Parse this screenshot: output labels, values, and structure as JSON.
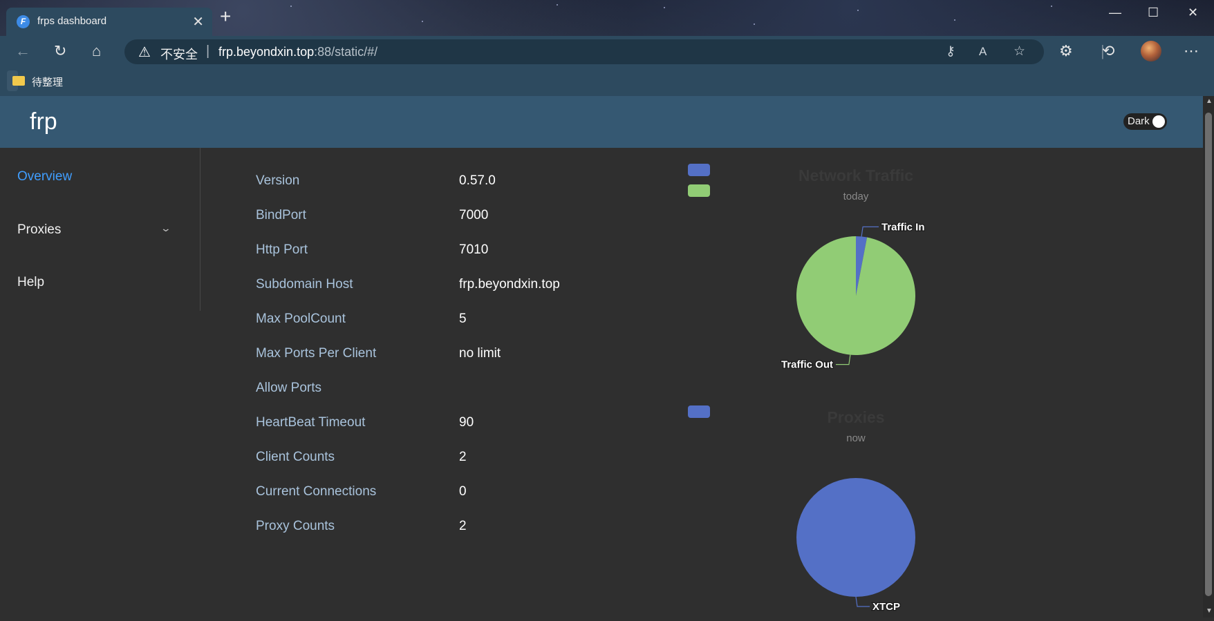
{
  "browser": {
    "tab_title": "frps dashboard",
    "security_label": "不安全",
    "url_host": "frp.beyondxin.top",
    "url_rest": ":88/static/#/",
    "bookmark_label": "待整理"
  },
  "header": {
    "logo": "frp",
    "dark_toggle_label": "Dark"
  },
  "sidebar": {
    "items": [
      {
        "label": "Overview",
        "active": true
      },
      {
        "label": "Proxies"
      },
      {
        "label": "Help"
      }
    ]
  },
  "server_info": [
    {
      "label": "Version",
      "value": "0.57.0"
    },
    {
      "label": "BindPort",
      "value": "7000"
    },
    {
      "label": "Http Port",
      "value": "7010"
    },
    {
      "label": "Subdomain Host",
      "value": "frp.beyondxin.top"
    },
    {
      "label": "Max PoolCount",
      "value": "5"
    },
    {
      "label": "Max Ports Per Client",
      "value": "no limit"
    },
    {
      "label": "Allow Ports",
      "value": ""
    },
    {
      "label": "HeartBeat Timeout",
      "value": "90"
    },
    {
      "label": "Client Counts",
      "value": "2"
    },
    {
      "label": "Current Connections",
      "value": "0"
    },
    {
      "label": "Proxy Counts",
      "value": "2"
    }
  ],
  "chart_data": [
    {
      "type": "pie",
      "title": "Network Traffic",
      "subtitle": "today",
      "categories": [
        "Traffic In",
        "Traffic Out"
      ],
      "values": [
        3,
        97
      ],
      "colors": [
        "#5470c6",
        "#91cc75"
      ],
      "legend_placement": "top-left"
    },
    {
      "type": "pie",
      "title": "Proxies",
      "subtitle": "now",
      "categories": [
        "XTCP"
      ],
      "values": [
        2
      ],
      "colors": [
        "#5470c6"
      ],
      "legend_placement": "top-left"
    }
  ],
  "colors": {
    "background": "#2f2f2f",
    "header": "#355872",
    "accent": "#409eff",
    "label": "#a9c3dc"
  }
}
